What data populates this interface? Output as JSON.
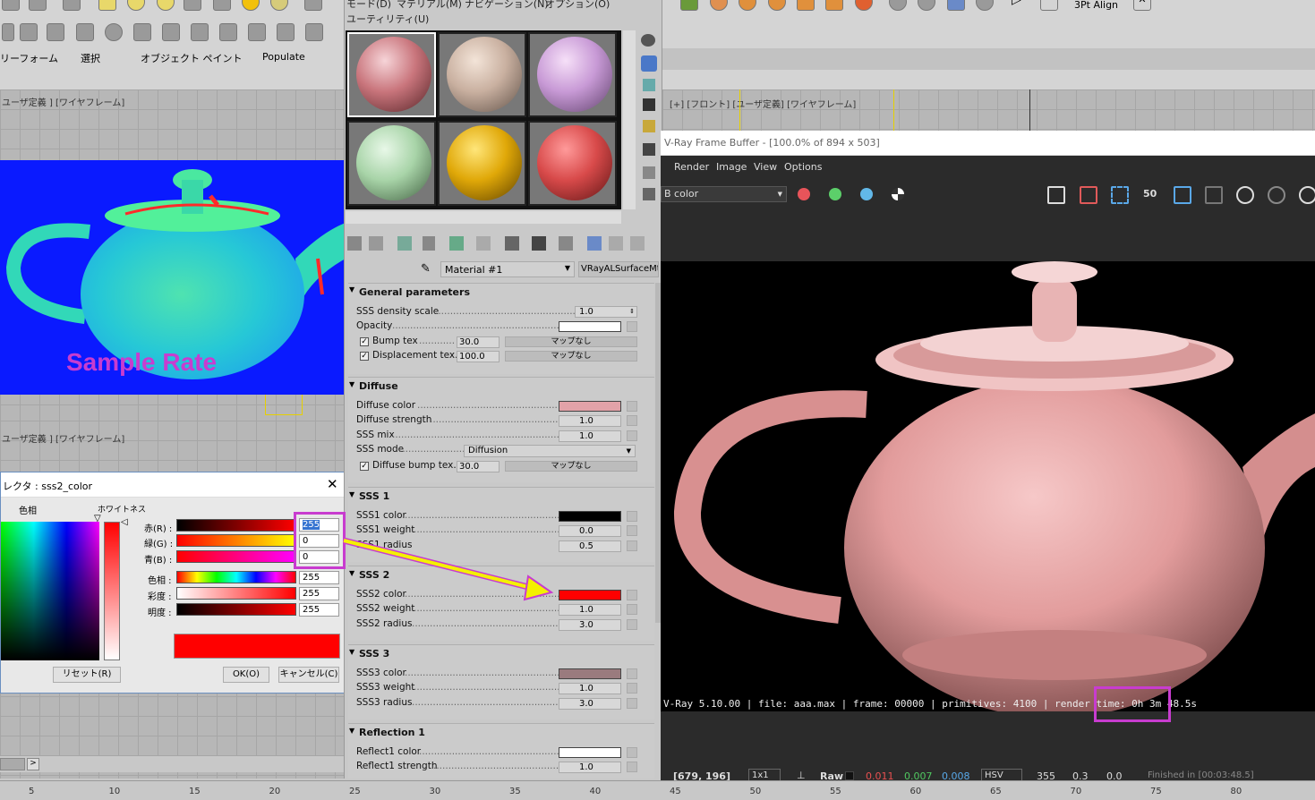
{
  "toolbar": {
    "menu_row1": [
      "リーフォーム",
      "選択",
      "オブジェクト ペイント",
      "Populate"
    ],
    "align_label": "3Pt Align"
  },
  "viewports": {
    "top_left_label": "ユーザ定義 ] [ワイヤフレーム]",
    "bottom_left_label": "ユーザ定義 ] [ワイヤフレーム]",
    "top_right_label": "[+] [フロント] [ユーザ定義] [ワイヤフレーム]",
    "sample_rate_text": "Sample Rate"
  },
  "material_editor": {
    "menu_items": [
      "モード(D)",
      "マテリアル(M)",
      "ナビゲーション(N)",
      "オプション(O)"
    ],
    "menu_item_utility": "ユーティリティ(U)",
    "material_name": "Material #1",
    "material_type": "VRayALSurfaceMtl",
    "sections": {
      "general": {
        "title": "General parameters",
        "sss_density_label": "SSS density scale",
        "sss_density_value": "1.0",
        "opacity_label": "Opacity",
        "opacity_color": "#ffffff",
        "bump_label": "Bump tex",
        "bump_value": "30.0",
        "bump_map": "マップなし",
        "disp_label": "Displacement tex.",
        "disp_value": "100.0",
        "disp_map": "マップなし"
      },
      "diffuse": {
        "title": "Diffuse",
        "color_label": "Diffuse color",
        "color": "#e2a2a8",
        "strength_label": "Diffuse strength",
        "strength_value": "1.0",
        "sss_mix_label": "SSS mix",
        "sss_mix_value": "1.0",
        "sss_mode_label": "SSS mode",
        "sss_mode_value": "Diffusion",
        "bump_label": "Diffuse bump tex.",
        "bump_value": "30.0",
        "bump_map": "マップなし"
      },
      "sss1": {
        "title": "SSS 1",
        "color_label": "SSS1 color",
        "color": "#000000",
        "weight_label": "SSS1 weight",
        "weight_value": "0.0",
        "radius_label": "SSS1 radius",
        "radius_value": "0.5"
      },
      "sss2": {
        "title": "SSS 2",
        "color_label": "SSS2 color",
        "color": "#ff0000",
        "weight_label": "SSS2 weight",
        "weight_value": "1.0",
        "radius_label": "SSS2 radius",
        "radius_value": "3.0"
      },
      "sss3": {
        "title": "SSS 3",
        "color_label": "SSS3 color",
        "color": "#9a7b7e",
        "weight_label": "SSS3 weight",
        "weight_value": "1.0",
        "radius_label": "SSS3 radius",
        "radius_value": "3.0"
      },
      "refl1": {
        "title": "Reflection 1",
        "color_label": "Reflect1 color",
        "color": "#ffffff",
        "strength_label": "Reflect1 strength",
        "strength_value": "1.0"
      }
    }
  },
  "color_selector": {
    "title": "レクタ : sss2_color",
    "hue_label": "色相",
    "whiteness_label": "ホワイトネス",
    "red_label": "赤(R) :",
    "red_value": "255",
    "green_label": "緑(G) :",
    "green_value": "0",
    "blue_label": "青(B) :",
    "blue_value": "0",
    "hue_row_label": "色相 :",
    "hue_value": "255",
    "sat_label": "彩度 :",
    "sat_value": "255",
    "val_label": "明度 :",
    "val_value": "255",
    "preview_color": "#ff0000",
    "reset_label": "リセット(R)",
    "ok_label": "OK(O)",
    "cancel_label": "キャンセル(C)"
  },
  "vfb": {
    "title": "V-Ray Frame Buffer - [100.0% of 894 x 503]",
    "menu": [
      "Render",
      "Image",
      "View",
      "Options"
    ],
    "channel": "B color",
    "stamp": "V-Ray 5.10.00 | file: aaa.max | frame: 00000 | primitives: 4100 | render time: 0h  3m 48.5s",
    "status": {
      "coords": "[679, 196]",
      "sampling": "1x1",
      "raw_label": "Raw",
      "r": "0.011",
      "g": "0.007",
      "b": "0.008",
      "mode": "HSV",
      "h": "355",
      "s": "0.3",
      "v": "0.0",
      "finished": "Finished in [00:03:48.5]"
    },
    "zoom_btn": "50"
  },
  "timeline": {
    "ticks": [
      "5",
      "10",
      "15",
      "20",
      "25",
      "30",
      "35",
      "40",
      "45",
      "50",
      "55",
      "60",
      "65",
      "70",
      "75",
      "80"
    ]
  }
}
